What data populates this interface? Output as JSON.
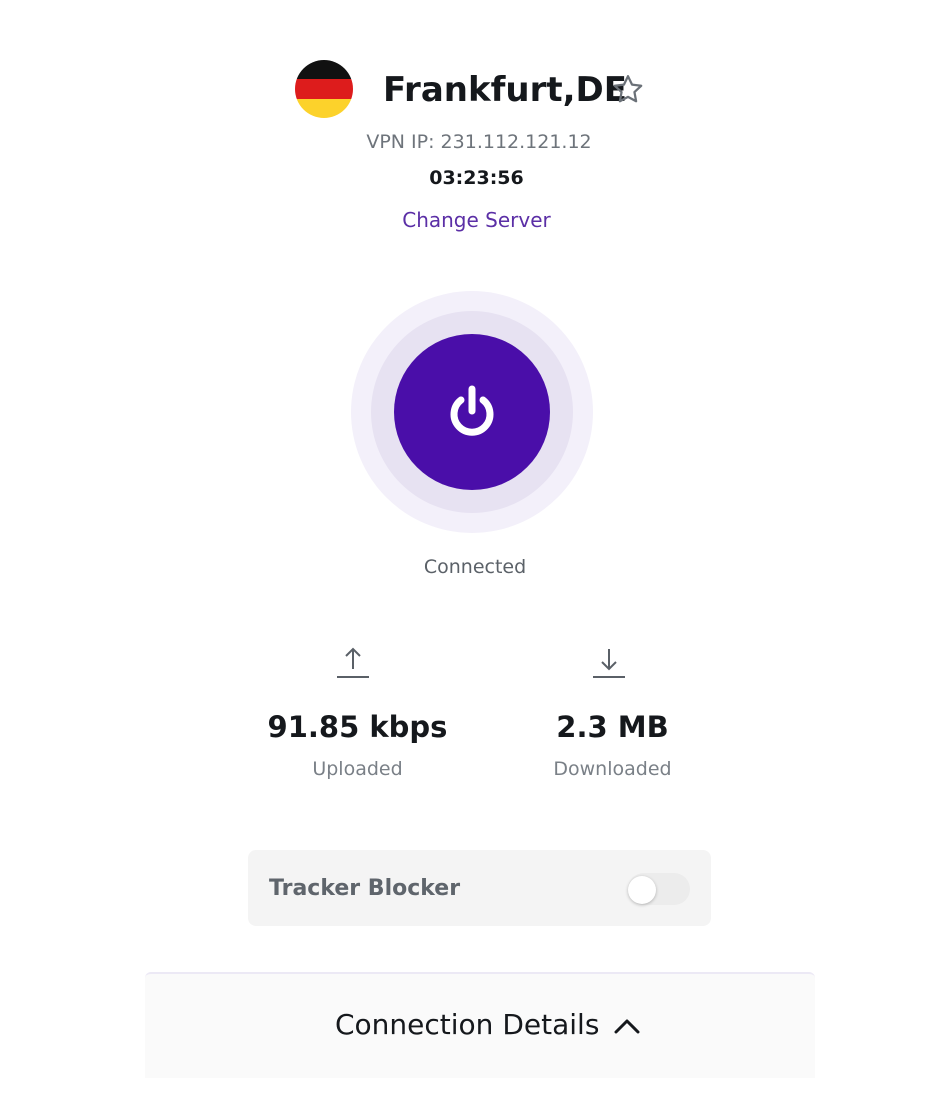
{
  "server": {
    "name": "Frankfurt,DE",
    "flag_colors": [
      "#111111",
      "#dd1c1c",
      "#fcd22b"
    ],
    "favorite_icon": "star-outline-icon",
    "vpn_ip": "VPN IP: 231.112.121.12",
    "timer": "03:23:56",
    "change_server_label": "Change Server"
  },
  "power": {
    "icon": "power-icon",
    "color": "#4a0ea9",
    "status": "Connected"
  },
  "stats": {
    "upload": {
      "icon": "upload-arrow-icon",
      "value": "91.85 kbps",
      "label": "Uploaded"
    },
    "download": {
      "icon": "download-arrow-icon",
      "value": "2.3 MB",
      "label": "Downloaded"
    }
  },
  "tracker_blocker": {
    "label": "Tracker Blocker",
    "enabled": false
  },
  "connection_details": {
    "label": "Connection Details",
    "icon": "chevron-up-icon"
  }
}
